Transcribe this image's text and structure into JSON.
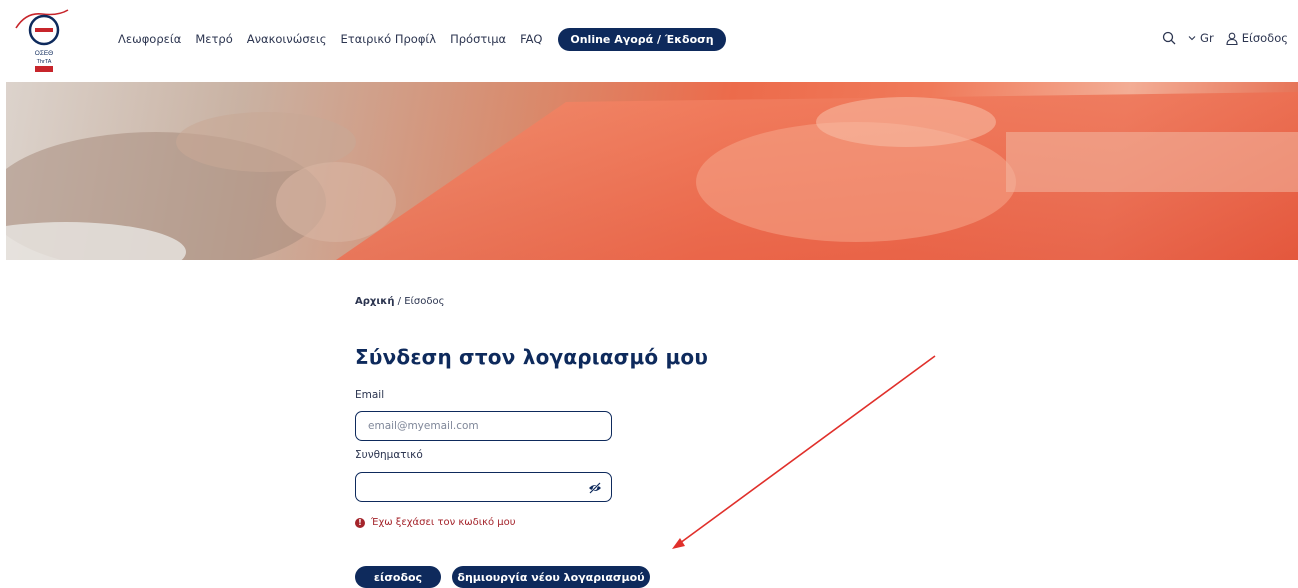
{
  "header": {
    "logo_text": "ΟΣΕΘ ThrTA",
    "nav": [
      "Λεωφορεία",
      "Μετρό",
      "Ανακοινώσεις",
      "Εταιρικό Προφίλ",
      "Πρόστιμα",
      "FAQ"
    ],
    "cta_label": "Online Αγορά / Έκδοση",
    "language": "Gr",
    "login_label": "Είσοδος"
  },
  "breadcrumb": {
    "home": "Αρχική",
    "separator": "/",
    "current": "Είσοδος"
  },
  "page_title": "Σύνδεση στον λογαριασμό μου",
  "form": {
    "email_label": "Email",
    "email_placeholder": "email@myemail.com",
    "password_label": "Συνθηματικό",
    "forgot_label": "Έχω ξεχάσει τον κωδικό μου",
    "login_button": "είσοδος",
    "create_account_button": "δημιουργία νέου λογαριασμού"
  },
  "colors": {
    "primary": "#0e2a5c",
    "error": "#a4242b",
    "annotation_arrow": "#e0302b"
  }
}
